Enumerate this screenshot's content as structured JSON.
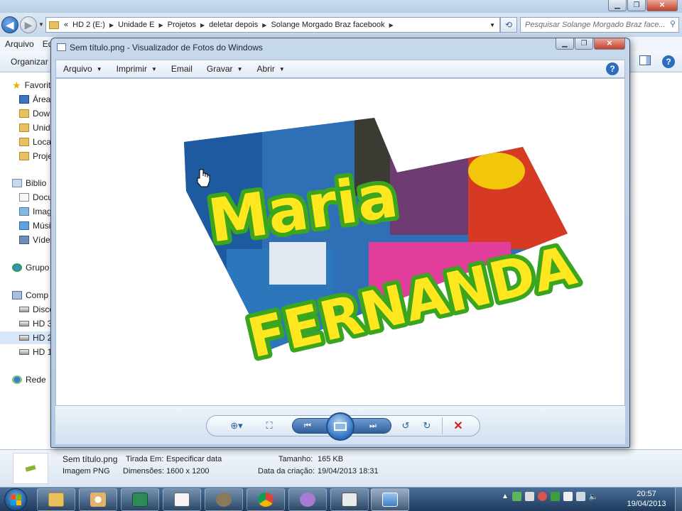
{
  "explorer": {
    "address": {
      "crumbs": [
        "HD 2 (E:)",
        "Unidade E",
        "Projetos",
        "deletar depois",
        "Solange Morgado Braz facebook"
      ],
      "overflow": "«"
    },
    "search_placeholder": "Pesquisar Solange Morgado Braz face...",
    "menu": {
      "arquivo": "Arquivo",
      "editar": "Ed"
    },
    "cmd": {
      "organizar": "Organizar"
    },
    "nav": {
      "favoritos": "Favorit",
      "area": "Área",
      "downloads": "Dow",
      "unidade": "Unid",
      "locais": "Loca",
      "projetos": "Proje",
      "bibliotecas": "Biblio",
      "documentos": "Docu",
      "imagens": "Imag",
      "musicas": "Músi",
      "videos": "Víde",
      "grupo": "Grupo",
      "computador": "Comp",
      "disco": "Disco",
      "hd3": "HD 3",
      "hd2": "HD 2",
      "hd1": "HD 1",
      "rede": "Rede"
    },
    "details": {
      "filename": "Sem título.png",
      "filetype": "Imagem PNG",
      "taken_label": "Tirada Em:",
      "taken_value": "Especificar data",
      "dims_label": "Dimensões:",
      "dims_value": "1600 x 1200",
      "size_label": "Tamanho:",
      "size_value": "165 KB",
      "created_label": "Data da criação:",
      "created_value": "19/04/2013 18:31"
    }
  },
  "viewer": {
    "title": "Sem título.png - Visualizador de Fotos do Windows",
    "menu": {
      "arquivo": "Arquivo",
      "imprimir": "Imprimir",
      "email": "Email",
      "gravar": "Gravar",
      "abrir": "Abrir"
    },
    "photo_text": {
      "line1": "Maria",
      "line2": "FERNANDA"
    }
  },
  "taskbar": {
    "time": "20:57",
    "date": "19/04/2013"
  },
  "colors": {
    "title_fill": "#ffe720",
    "title_outline": "#3aa51d",
    "accent": "#2a6ebd"
  }
}
